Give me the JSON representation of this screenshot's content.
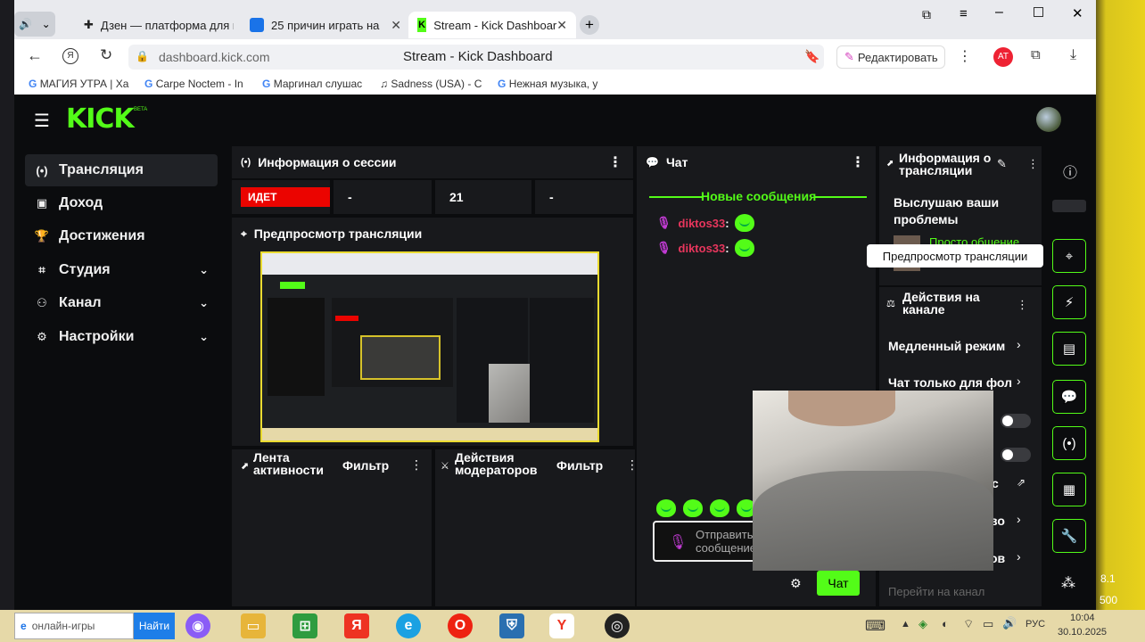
{
  "browser": {
    "tabs": [
      {
        "label": "Дзен — платформа для п",
        "icon": "plus-icon"
      },
      {
        "label": "25 причин играть на",
        "icon": "play-icon"
      },
      {
        "label": "Stream - Kick Dashboar",
        "icon": "kick-logo-icon",
        "active": true
      }
    ],
    "url": "dashboard.kick.com",
    "page_title": "Stream - Kick Dashboard",
    "edit_label": "Редактировать",
    "bookmarks": [
      "МАГИЯ УТРА | Ха",
      "Carpe Noctem - In",
      "Маргинал слушас",
      "Sadness (USA) - C",
      "Нежная музыка, у"
    ]
  },
  "app": {
    "logo": "KICK",
    "beta": "BETA",
    "nav": [
      {
        "label": "Трансляция",
        "icon": "broadcast-icon",
        "active": true,
        "chevron": false
      },
      {
        "label": "Доход",
        "icon": "money-icon",
        "chevron": false
      },
      {
        "label": "Достижения",
        "icon": "trophy-icon",
        "chevron": false
      },
      {
        "label": "Студия",
        "icon": "studio-icon",
        "chevron": true
      },
      {
        "label": "Канал",
        "icon": "channel-icon",
        "chevron": true
      },
      {
        "label": "Настройки",
        "icon": "gear-icon",
        "chevron": true
      }
    ],
    "session": {
      "title": "Информация о сессии",
      "status": "ИДЕТ",
      "stats": [
        "-",
        "21",
        "-"
      ]
    },
    "preview_title": "Предпросмотр трансляции",
    "activity": {
      "title": "Лента активности",
      "filter": "Фильтр"
    },
    "moderators": {
      "title": "Действия модераторов",
      "filter": "Фильтр"
    },
    "chat": {
      "title": "Чат",
      "new_messages": "Новые сообщения",
      "messages": [
        {
          "user": "diktos33",
          "sep": ":"
        },
        {
          "user": "diktos33",
          "sep": ":"
        }
      ],
      "input_placeholder": "Отправить сообщение",
      "send_label": "Чат"
    },
    "stream_info": {
      "title": "Информация о трансляции",
      "stream_title": "Выслушаю ваши проблемы",
      "category": "Просто общение"
    },
    "tooltip": "Предпросмотр трансляции",
    "channel_actions": {
      "title": "Действия на канале",
      "items": [
        "Медленный режим",
        "Чат только для фол"
      ],
      "go_to_channel": "Перейти на канал"
    },
    "partial_labels": [
      "с",
      "во",
      "ов"
    ]
  },
  "taskbar": {
    "search_text": "онлайн-игры",
    "search_button": "Найти",
    "lang": "РУС",
    "time": "10:04",
    "date": "30.10.2025",
    "side_numbers": [
      "8.1",
      "500"
    ]
  },
  "colors": {
    "accent": "#53fc18",
    "live": "#eb0400",
    "bg": "#0b0c0e",
    "panel": "#18191c"
  }
}
